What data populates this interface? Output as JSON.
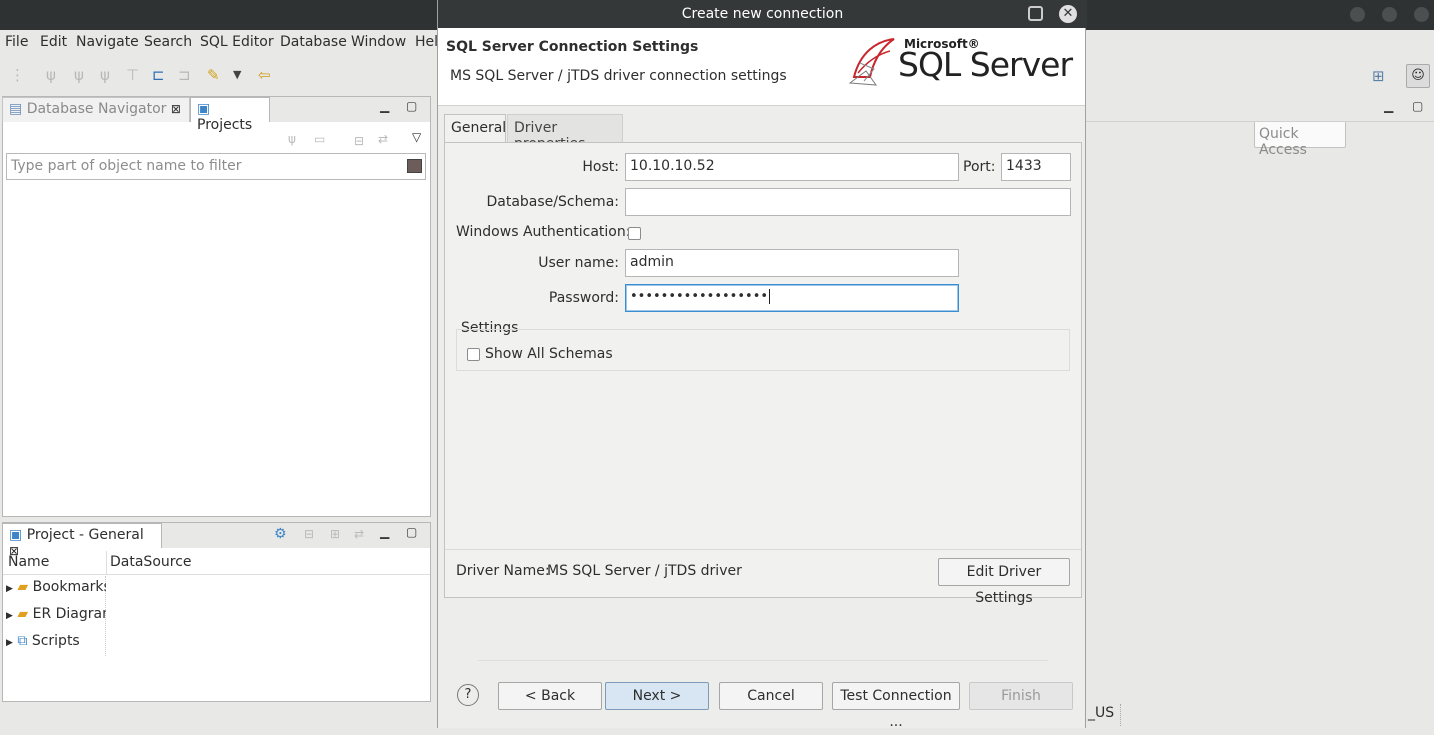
{
  "menu": [
    "File",
    "Edit",
    "Navigate",
    "Search",
    "SQL Editor",
    "Database",
    "Window",
    "Help"
  ],
  "quick_access": "Quick Access",
  "navigator": {
    "tab_label": "Database Navigator",
    "tab2_label": "Projects",
    "filter_placeholder": "Type part of object name to filter"
  },
  "project_panel": {
    "title": "Project - General",
    "columns": [
      "Name",
      "DataSource"
    ],
    "rows": [
      "Bookmarks",
      "ER Diagrams",
      "Scripts"
    ]
  },
  "status_fragment": "_US",
  "dialog": {
    "title": "Create new connection",
    "header_title": "SQL Server Connection Settings",
    "header_subtitle": "MS SQL Server / jTDS driver connection settings",
    "logo_small": "Microsoft®",
    "logo_big": "SQL Server",
    "tabs": [
      "General",
      "Driver properties"
    ],
    "host_label": "Host:",
    "host_value": "10.10.10.52",
    "port_label": "Port:",
    "port_value": "1433",
    "db_label": "Database/Schema:",
    "db_value": "",
    "winauth_label": "Windows Authentication:",
    "user_label": "User name:",
    "user_value": "admin",
    "password_label": "Password:",
    "password_value": "••••••••••••••••••",
    "settings_label": "Settings",
    "show_schemas_label": "Show All Schemas",
    "driver_name_label": "Driver Name:",
    "driver_name_value": "MS SQL Server / jTDS driver",
    "edit_driver_button": "Edit Driver Settings",
    "back_button": "< Back",
    "next_button": "Next >",
    "cancel_button": "Cancel",
    "test_button": "Test Connection ...",
    "finish_button": "Finish",
    "help_icon": "?"
  }
}
